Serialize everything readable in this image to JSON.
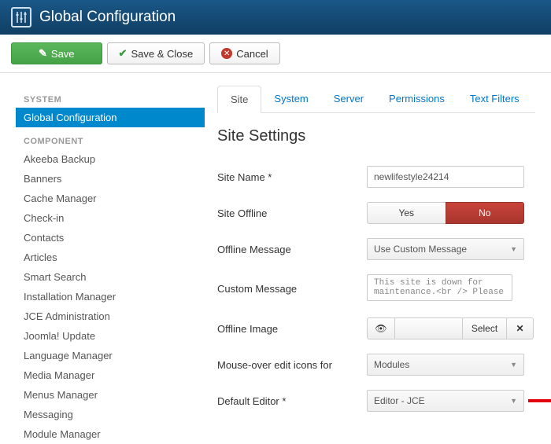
{
  "header": {
    "title": "Global Configuration"
  },
  "toolbar": {
    "save": "Save",
    "save_close": "Save & Close",
    "cancel": "Cancel"
  },
  "sidebar": {
    "system_head": "SYSTEM",
    "system_items": [
      "Global Configuration"
    ],
    "component_head": "COMPONENT",
    "component_items": [
      "Akeeba Backup",
      "Banners",
      "Cache Manager",
      "Check-in",
      "Contacts",
      "Articles",
      "Smart Search",
      "Installation Manager",
      "JCE Administration",
      "Joomla! Update",
      "Language Manager",
      "Media Manager",
      "Menus Manager",
      "Messaging",
      "Module Manager"
    ]
  },
  "tabs": [
    "Site",
    "System",
    "Server",
    "Permissions",
    "Text Filters"
  ],
  "section_title": "Site Settings",
  "fields": {
    "site_name": {
      "label": "Site Name *",
      "value": "newlifestyle24214"
    },
    "site_offline": {
      "label": "Site Offline",
      "yes": "Yes",
      "no": "No"
    },
    "offline_message": {
      "label": "Offline Message",
      "value": "Use Custom Message"
    },
    "custom_message": {
      "label": "Custom Message",
      "value": "This site is down for maintenance.<br /> Please"
    },
    "offline_image": {
      "label": "Offline Image",
      "select": "Select"
    },
    "mouseover": {
      "label": "Mouse-over edit icons for",
      "value": "Modules"
    },
    "default_editor": {
      "label": "Default Editor *",
      "value": "Editor - JCE"
    }
  }
}
